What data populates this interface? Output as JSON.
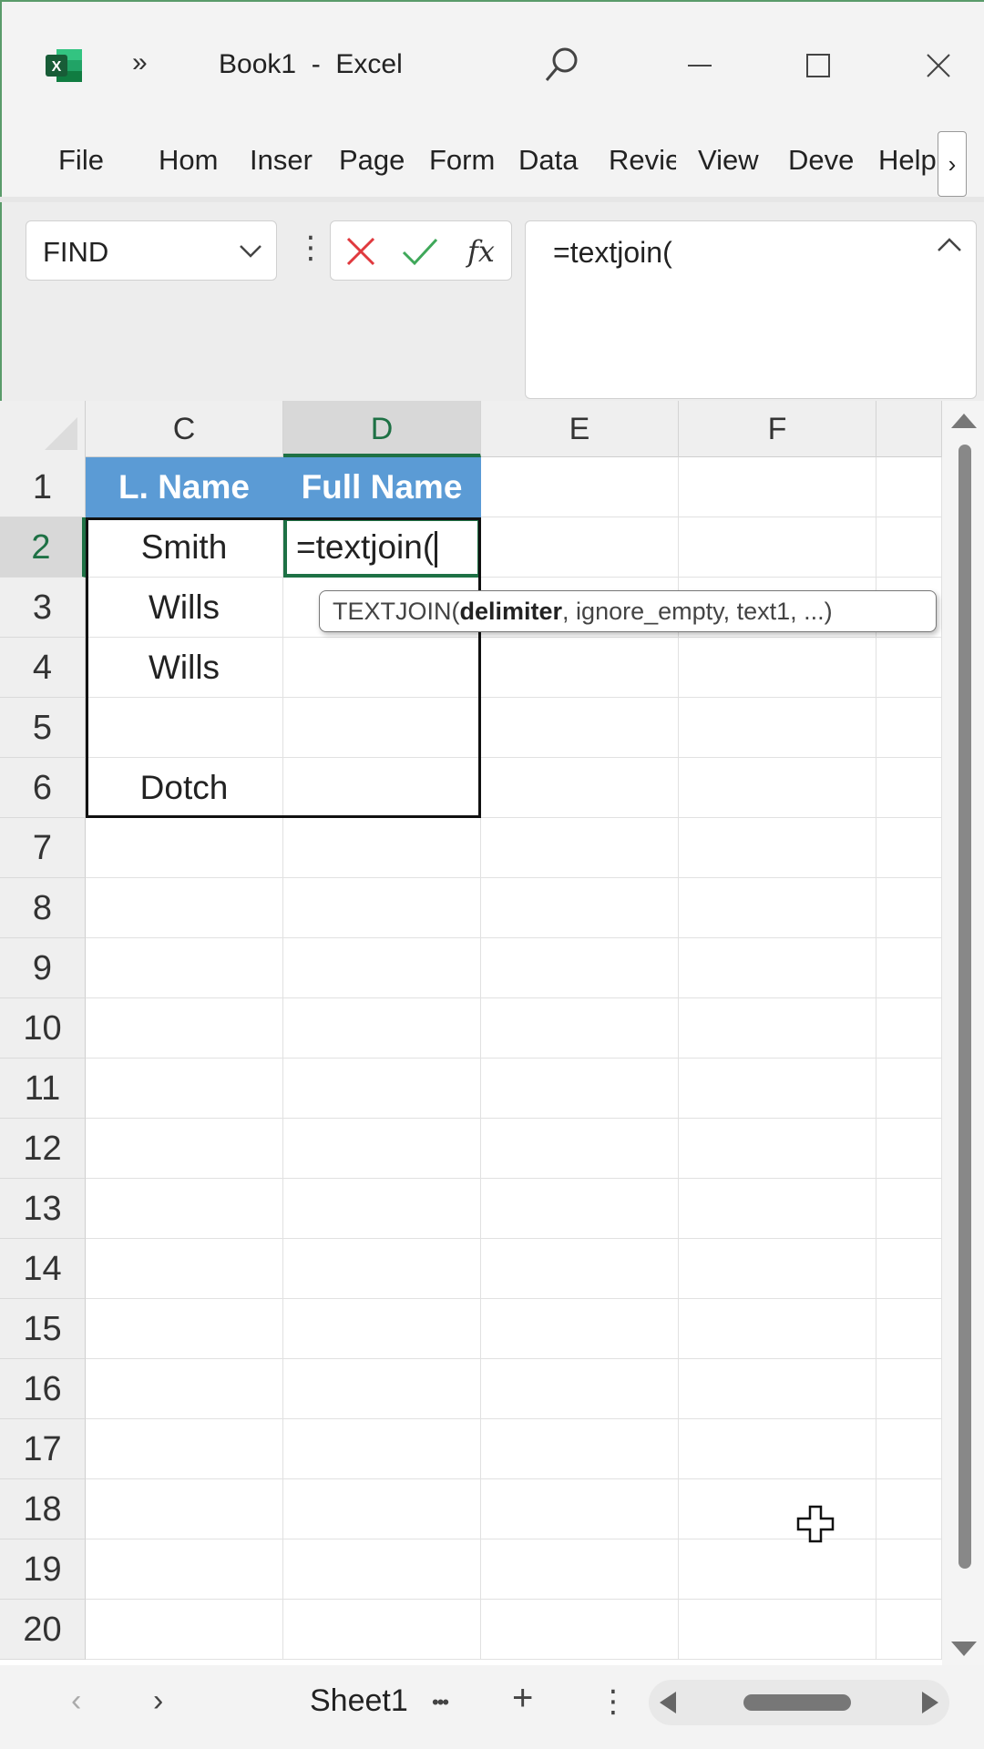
{
  "window": {
    "title": "Book1  -  Excel",
    "overflow_glyph": "»",
    "accent_color": "#1e7145"
  },
  "ribbon": {
    "tabs": [
      "File",
      "Hom",
      "Inser",
      "Page",
      "Form",
      "Data",
      "Revie",
      "View",
      "Deve",
      "Help"
    ],
    "more_glyph": "›"
  },
  "formula_bar": {
    "name_box": "FIND",
    "more_glyph": "⋮",
    "formula": "=textjoin("
  },
  "grid": {
    "columns": [
      "C",
      "D",
      "E",
      "F"
    ],
    "rows": [
      "1",
      "2",
      "3",
      "4",
      "5",
      "6",
      "7",
      "8",
      "9",
      "10",
      "11",
      "12",
      "13",
      "14",
      "15",
      "16",
      "17",
      "18",
      "19",
      "20"
    ],
    "header_cells": {
      "c1": "L. Name",
      "d1": "Full Name"
    },
    "cells": {
      "c2": "Smith",
      "c3": "Wills",
      "c4": "Wills",
      "c5": "",
      "c6": "Dotch",
      "d2": "=textjoin("
    },
    "header_fill": "#5b9bd5",
    "tooltip": {
      "func": "TEXTJOIN(",
      "bold_arg": "delimiter",
      "rest": ", ignore_empty, text1, ...)"
    }
  },
  "sheet_bar": {
    "prev": "‹",
    "next": "›",
    "sheet_name": "Sheet1",
    "dots": "•••",
    "add": "+",
    "menu": "⋮"
  }
}
